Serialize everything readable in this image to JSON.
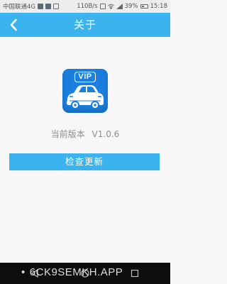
{
  "status_bar": {
    "carrier": "中国联通4G",
    "speed": "110B/s",
    "battery": "39%",
    "time": "15:18"
  },
  "header": {
    "title": "关于",
    "back_icon": "chevron-left-icon"
  },
  "app": {
    "logo_text": "VIP",
    "logo_icon": "car-icon",
    "version_label": "当前版本",
    "version_value": "V1.0.6"
  },
  "actions": {
    "check_update_label": "检查更新"
  },
  "nav_bar": {
    "icons": [
      "back-icon",
      "home-icon",
      "recent-apps-icon"
    ]
  },
  "watermark": {
    "text": "6CK9SEMKH.APP"
  },
  "colors": {
    "accent": "#3ab3ee",
    "logo_blue": "#1b7fe0",
    "background": "#f7f7f7",
    "nav_bar": "#0e0e0e"
  }
}
